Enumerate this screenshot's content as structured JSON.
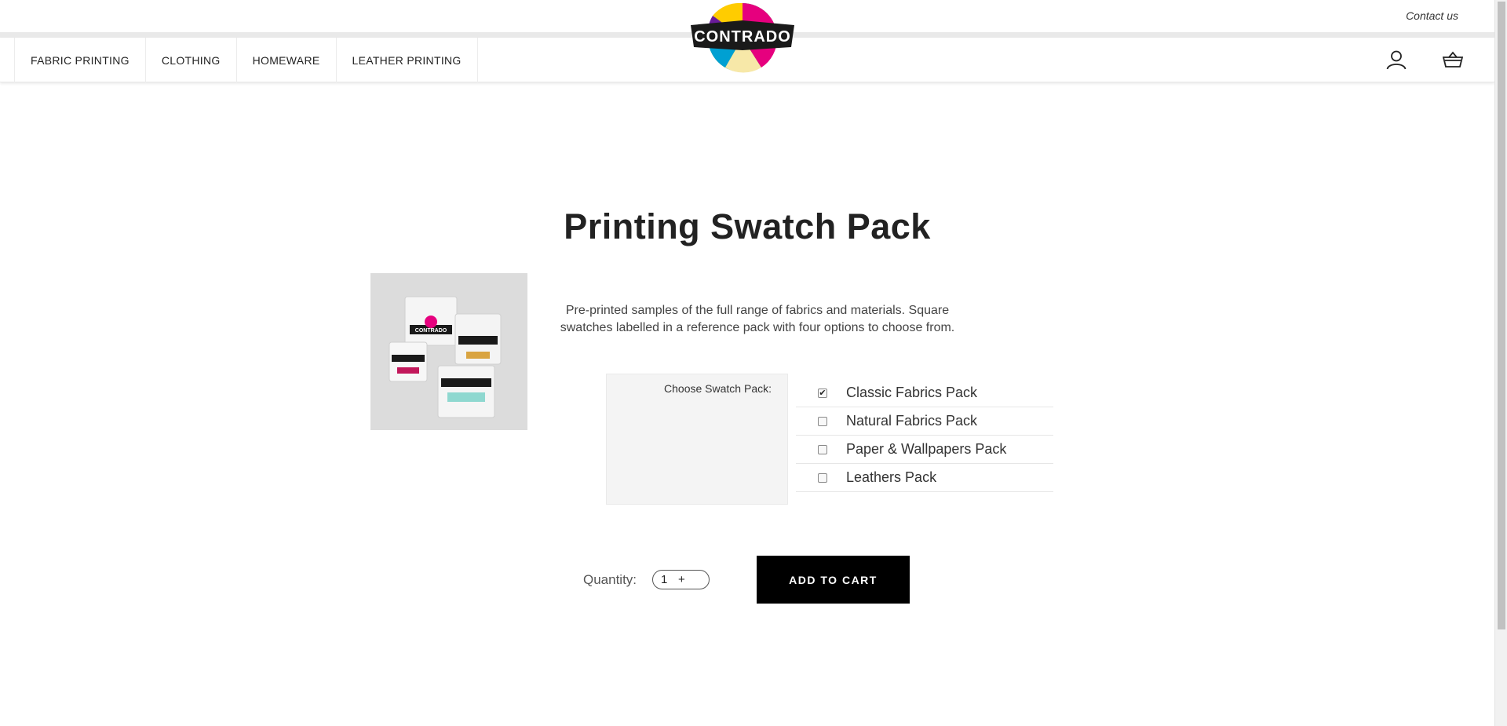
{
  "header": {
    "contact_label": "Contact us",
    "logo_text": "CONTRADO"
  },
  "nav": {
    "items": [
      {
        "label": "FABRIC PRINTING"
      },
      {
        "label": "CLOTHING"
      },
      {
        "label": "HOMEWARE"
      },
      {
        "label": "LEATHER PRINTING"
      }
    ]
  },
  "icons": {
    "account": "user-icon",
    "basket": "basket-icon"
  },
  "product": {
    "title": "Printing Swatch Pack",
    "description": "Pre-printed samples of the full range of fabrics and materials. Square swatches labelled in a reference pack with four options to choose from.",
    "image_logo_text": "CONTRADO"
  },
  "options": {
    "label": "Choose Swatch Pack:",
    "items": [
      {
        "label": "Classic Fabrics Pack",
        "checked": true
      },
      {
        "label": "Natural Fabrics Pack",
        "checked": false
      },
      {
        "label": "Paper & Wallpapers Pack",
        "checked": false
      },
      {
        "label": "Leathers Pack",
        "checked": false
      }
    ]
  },
  "cart": {
    "quantity_label": "Quantity:",
    "quantity_value": "1",
    "plus_label": "+",
    "add_button_label": "ADD TO CART"
  },
  "colors": {
    "accent": "#000000",
    "background": "#ffffff"
  }
}
